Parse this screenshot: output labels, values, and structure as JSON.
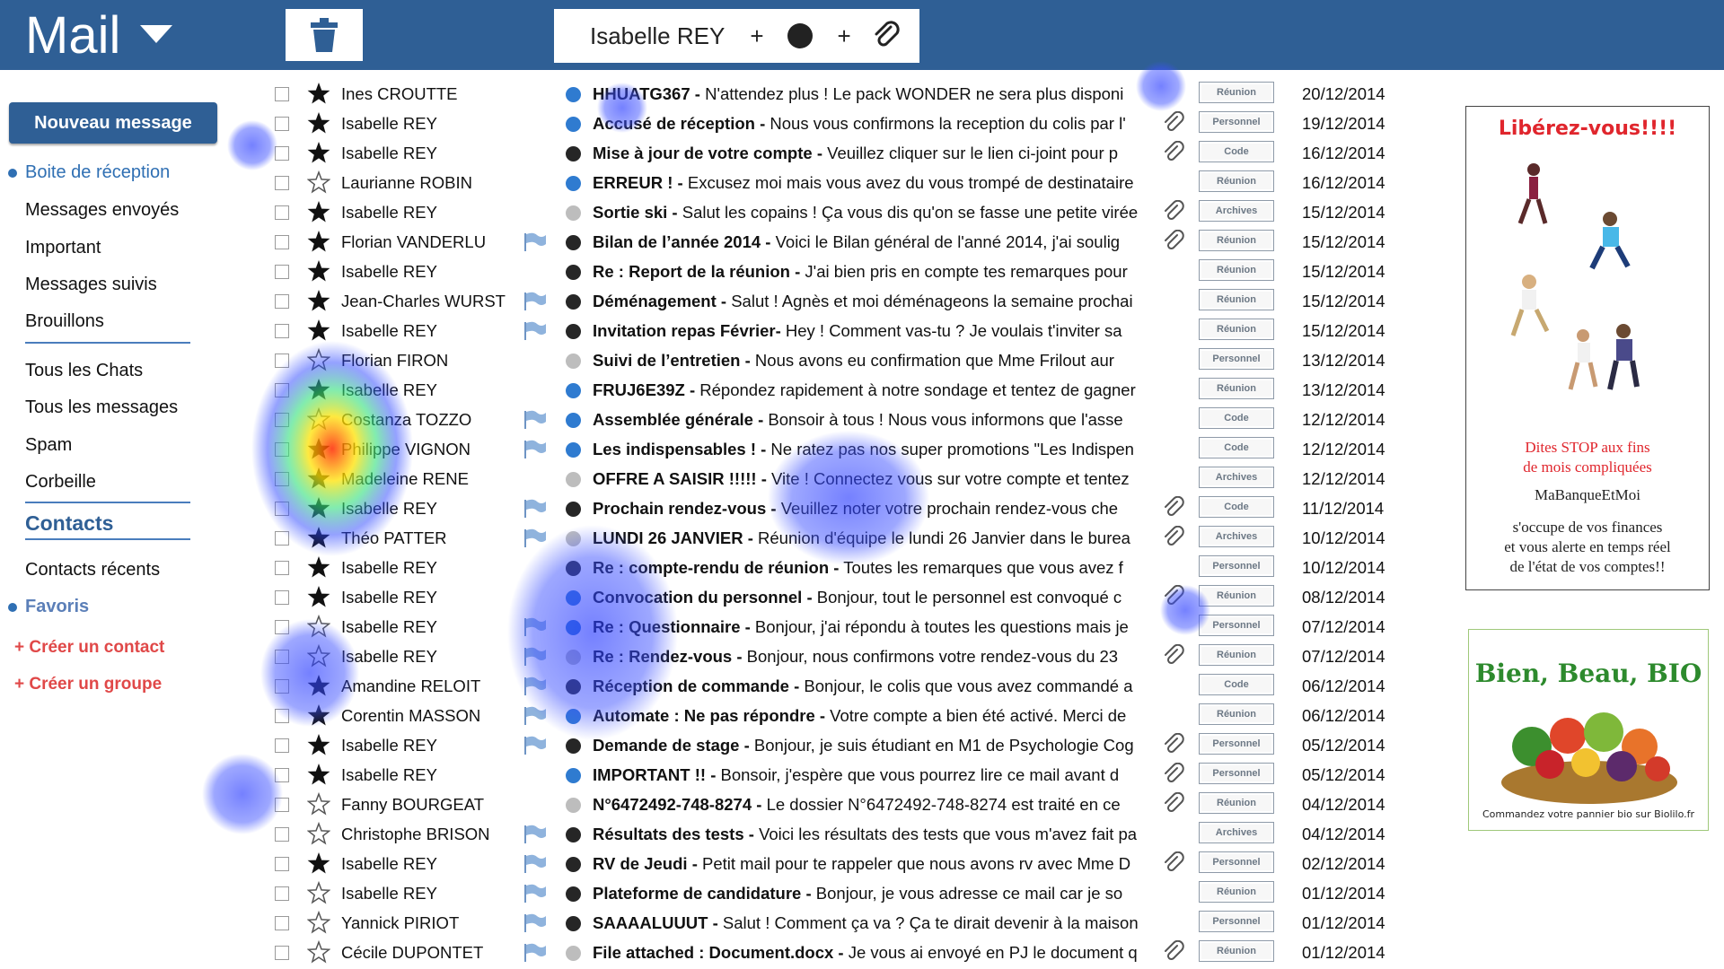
{
  "header": {
    "app_title": "Mail",
    "filter_name": "Isabelle REY",
    "filter_plus": "+"
  },
  "sidebar": {
    "new_message": "Nouveau message",
    "items": [
      {
        "label": "Boite de réception"
      },
      {
        "label": "Messages envoyés"
      },
      {
        "label": "Important"
      },
      {
        "label": "Messages suivis"
      },
      {
        "label": "Brouillons"
      },
      {
        "label": "Tous les Chats"
      },
      {
        "label": "Tous les messages"
      },
      {
        "label": "Spam"
      },
      {
        "label": "Corbeille"
      }
    ],
    "contacts_title": "Contacts",
    "recent_contacts": "Contacts récents",
    "favorites": "Favoris",
    "create_contact": "+ Créer un contact",
    "create_group": "+ Créer un groupe"
  },
  "colors": {
    "header": "#2f5f95",
    "dot_blue": "#2f7bd0",
    "dot_black": "#262626",
    "dot_gray": "#bdbdbd",
    "accent_red": "#e04848"
  },
  "mails": [
    {
      "sender": "Ines CROUTTE",
      "starred": true,
      "flag": false,
      "dot": "blue",
      "subject": "HHUATG367 -",
      "preview": " N'attendez plus ! Le pack WONDER ne sera plus disponi",
      "clip": false,
      "tag": "Réunion",
      "date": "20/12/2014"
    },
    {
      "sender": "Isabelle REY",
      "starred": true,
      "flag": false,
      "dot": "blue",
      "subject": "Accusé de réception -",
      "preview": " Nous vous confirmons la reception du colis par l'",
      "clip": true,
      "tag": "Personnel",
      "date": "19/12/2014"
    },
    {
      "sender": "Isabelle REY",
      "starred": true,
      "flag": false,
      "dot": "black",
      "subject": "Mise à jour de votre compte -",
      "preview": " Veuillez cliquer sur le lien ci-joint pour p",
      "clip": true,
      "tag": "Code",
      "date": "16/12/2014"
    },
    {
      "sender": "Laurianne ROBIN",
      "starred": false,
      "flag": false,
      "dot": "blue",
      "subject": "ERREUR ! -",
      "preview": " Excusez moi mais vous avez du vous trompé de destinataire",
      "clip": false,
      "tag": "Réunion",
      "date": "16/12/2014"
    },
    {
      "sender": "Isabelle REY",
      "starred": true,
      "flag": false,
      "dot": "gray",
      "subject": "Sortie ski -",
      "preview": " Salut les copains ! Ça vous dis qu'on se fasse une petite virée",
      "clip": true,
      "tag": "Archives",
      "date": "15/12/2014"
    },
    {
      "sender": "Florian VANDERLU",
      "starred": true,
      "flag": true,
      "dot": "black",
      "subject": "Bilan de l’année 2014 -",
      "preview": " Voici le Bilan général de l'anné 2014, j'ai soulig",
      "clip": true,
      "tag": "Réunion",
      "date": "15/12/2014"
    },
    {
      "sender": "Isabelle REY",
      "starred": true,
      "flag": false,
      "dot": "black",
      "subject": "Re : Report de la réunion -",
      "preview": " J'ai bien pris en compte tes remarques pour",
      "clip": false,
      "tag": "Réunion",
      "date": "15/12/2014"
    },
    {
      "sender": "Jean-Charles WURST",
      "starred": true,
      "flag": true,
      "dot": "black",
      "subject": "Déménagement -",
      "preview": " Salut ! Agnès et moi déménageons la semaine prochai",
      "clip": false,
      "tag": "Réunion",
      "date": "15/12/2014"
    },
    {
      "sender": "Isabelle REY",
      "starred": true,
      "flag": true,
      "dot": "black",
      "subject": "Invitation repas Février-",
      "preview": " Hey ! Comment vas-tu ? Je voulais t'inviter sa",
      "clip": false,
      "tag": "Réunion",
      "date": "15/12/2014"
    },
    {
      "sender": "Florian FIRON",
      "starred": false,
      "flag": false,
      "dot": "gray",
      "subject": "Suivi de l’entretien -",
      "preview": " Nous avons eu confirmation que Mme Frilout aur",
      "clip": false,
      "tag": "Personnel",
      "date": "13/12/2014"
    },
    {
      "sender": "Isabelle REY",
      "starred": true,
      "flag": false,
      "dot": "blue",
      "subject": "FRUJ6E39Z -",
      "preview": " Répondez rapidement à notre sondage et tentez de gagner",
      "clip": false,
      "tag": "Réunion",
      "date": "13/12/2014"
    },
    {
      "sender": "Costanza TOZZO",
      "starred": false,
      "flag": true,
      "dot": "blue",
      "subject": "Assemblée générale -",
      "preview": " Bonsoir à tous ! Nous vous informons que l'asse",
      "clip": false,
      "tag": "Code",
      "date": "12/12/2014"
    },
    {
      "sender": "Philippe VIGNON",
      "starred": true,
      "flag": true,
      "dot": "blue",
      "subject": "Les indispensables ! -",
      "preview": " Ne ratez pas nos super promotions \"Les Indispen",
      "clip": false,
      "tag": "Code",
      "date": "12/12/2014"
    },
    {
      "sender": "Madeleine RENE",
      "starred": true,
      "flag": false,
      "dot": "gray",
      "subject": "OFFRE A SAISIR !!!!! -",
      "preview": " Vite ! Connectez vous sur votre compte et tentez",
      "clip": false,
      "tag": "Archives",
      "date": "12/12/2014"
    },
    {
      "sender": "Isabelle REY",
      "starred": true,
      "flag": true,
      "dot": "black",
      "subject": "Prochain rendez-vous -",
      "preview": " Veuillez noter votre prochain rendez-vous che",
      "clip": true,
      "tag": "Code",
      "date": "11/12/2014"
    },
    {
      "sender": "Théo PATTER",
      "starred": true,
      "flag": true,
      "dot": "gray",
      "subject": "LUNDI 26 JANVIER -",
      "preview": " Réunion d'équipe le lundi 26 Janvier dans le burea",
      "clip": true,
      "tag": "Archives",
      "date": "10/12/2014"
    },
    {
      "sender": "Isabelle REY",
      "starred": true,
      "flag": false,
      "dot": "black",
      "subject": "Re : compte-rendu de réunion -",
      "preview": "  Toutes les remarques que vous avez f",
      "clip": false,
      "tag": "Personnel",
      "date": "10/12/2014"
    },
    {
      "sender": "Isabelle REY",
      "starred": true,
      "flag": false,
      "dot": "blue",
      "subject": "Convocation du personnel -",
      "preview": " Bonjour, tout le personnel est convoqué c",
      "clip": true,
      "tag": "Réunion",
      "date": "08/12/2014"
    },
    {
      "sender": "Isabelle REY",
      "starred": false,
      "flag": true,
      "dot": "blue",
      "subject": "Re : Questionnaire -",
      "preview": " Bonjour, j'ai répondu à toutes les questions mais je",
      "clip": false,
      "tag": "Personnel",
      "date": "07/12/2014"
    },
    {
      "sender": "Isabelle REY",
      "starred": false,
      "flag": true,
      "dot": "gray",
      "subject": "Re : Rendez-vous -",
      "preview": " Bonjour, nous confirmons votre rendez-vous du 23",
      "clip": true,
      "tag": "Réunion",
      "date": "07/12/2014"
    },
    {
      "sender": "Amandine RELOIT",
      "starred": true,
      "flag": true,
      "dot": "black",
      "subject": "Réception de commande -",
      "preview": " Bonjour, le colis que vous avez commandé a",
      "clip": false,
      "tag": "Code",
      "date": "06/12/2014"
    },
    {
      "sender": "Corentin MASSON",
      "starred": true,
      "flag": true,
      "dot": "blue",
      "subject": "Automate : Ne pas répondre -",
      "preview": " Votre compte a bien été activé. Merci de",
      "clip": false,
      "tag": "Réunion",
      "date": "06/12/2014"
    },
    {
      "sender": "Isabelle REY",
      "starred": true,
      "flag": true,
      "dot": "black",
      "subject": "Demande de stage -",
      "preview": " Bonjour, je suis étudiant en M1 de Psychologie Cog",
      "clip": true,
      "tag": "Personnel",
      "date": "05/12/2014"
    },
    {
      "sender": "Isabelle REY",
      "starred": true,
      "flag": false,
      "dot": "blue",
      "subject": "IMPORTANT !! -",
      "preview": " Bonsoir, j'espère que vous pourrez lire ce mail avant d",
      "clip": true,
      "tag": "Personnel",
      "date": "05/12/2014"
    },
    {
      "sender": "Fanny BOURGEAT",
      "starred": false,
      "flag": false,
      "dot": "gray",
      "subject": "N°6472492-748-8274 -",
      "preview": " Le dossier N°6472492-748-8274 est traité en ce",
      "clip": true,
      "tag": "Réunion",
      "date": "04/12/2014"
    },
    {
      "sender": "Christophe BRISON",
      "starred": false,
      "flag": true,
      "dot": "black",
      "subject": "Résultats des tests -",
      "preview": " Voici les résultats des tests que vous m'avez fait pa",
      "clip": false,
      "tag": "Archives",
      "date": "04/12/2014"
    },
    {
      "sender": "Isabelle REY",
      "starred": true,
      "flag": true,
      "dot": "black",
      "subject": "RV de Jeudi -",
      "preview": " Petit mail pour te rappeler que nous avons rv avec Mme D",
      "clip": true,
      "tag": "Personnel",
      "date": "02/12/2014"
    },
    {
      "sender": "Isabelle REY",
      "starred": false,
      "flag": true,
      "dot": "black",
      "subject": "Plateforme de candidature -",
      "preview": " Bonjour, je vous adresse ce mail car je so",
      "clip": false,
      "tag": "Réunion",
      "date": "01/12/2014"
    },
    {
      "sender": "Yannick PIRIOT",
      "starred": false,
      "flag": true,
      "dot": "black",
      "subject": "SAAAALUUUT -",
      "preview": " Salut ! Comment ça va ? Ça te dirait devenir à la maison",
      "clip": false,
      "tag": "Personnel",
      "date": "01/12/2014"
    },
    {
      "sender": "Cécile DUPONTET",
      "starred": false,
      "flag": true,
      "dot": "gray",
      "subject": "File attached : Document.docx -",
      "preview": " Je vous ai envoyé en PJ le document q",
      "clip": true,
      "tag": "Réunion",
      "date": "01/12/2014"
    }
  ],
  "ads": {
    "ad1_title": "Libérez-vous!!!!",
    "ad1_line1": "Dites STOP aux fins",
    "ad1_line2": "de mois compliquées",
    "ad1_brand": "MaBanqueEtMoi",
    "ad1_body1": "s'occupe de vos finances",
    "ad1_body2": "et vous alerte en temps réel",
    "ad1_body3": "de l'état de vos comptes!!",
    "ad2_title": "Bien, Beau, BIO",
    "ad2_caption": "Commandez votre pannier bio sur Biolilo.fr"
  }
}
